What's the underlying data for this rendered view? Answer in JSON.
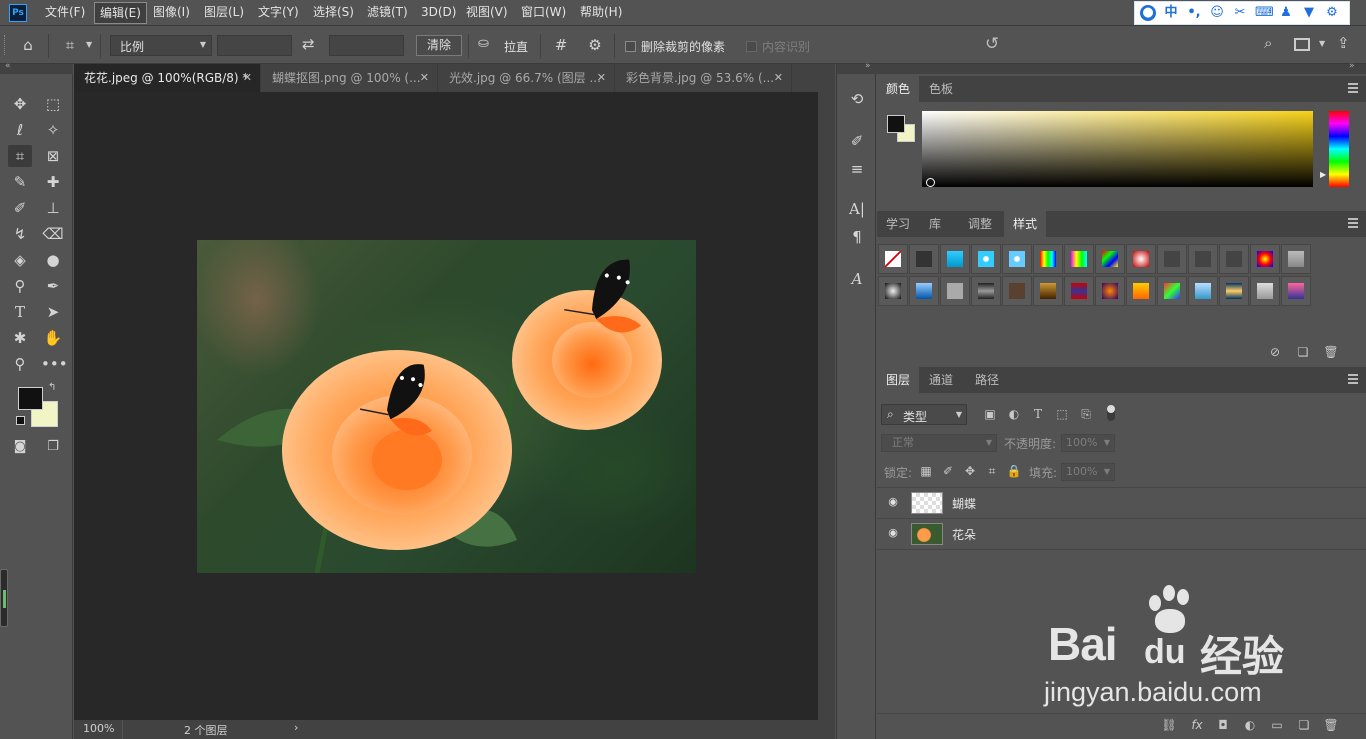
{
  "app": {
    "logo_text": "Ps"
  },
  "menu": {
    "items": [
      "文件(F)",
      "编辑(E)",
      "图像(I)",
      "图层(L)",
      "文字(Y)",
      "选择(S)",
      "滤镜(T)",
      "3D(D)",
      "视图(V)",
      "窗口(W)",
      "帮助(H)"
    ],
    "active": "编辑(E)"
  },
  "ime": {
    "lang": "中"
  },
  "options": {
    "ratio_select": "比例",
    "clear_button": "清除",
    "straighten_label": "拉直",
    "delete_cropped_label": "删除裁剪的像素",
    "content_aware_label": "内容识别"
  },
  "tabs": [
    {
      "label": "花花.jpeg @ 100%(RGB/8) *",
      "active": true
    },
    {
      "label": "蝴蝶抠图.png @ 100% (...",
      "active": false
    },
    {
      "label": "光效.jpg @ 66.7% (图层 ...",
      "active": false
    },
    {
      "label": "彩色背景.jpg @ 53.6% (...",
      "active": false
    }
  ],
  "status": {
    "zoom": "100%",
    "info": "2 个图层",
    "arrow": "›"
  },
  "color_panel": {
    "tabs": [
      "颜色",
      "色板"
    ],
    "active": "颜色",
    "foreground": "#111111",
    "background": "#f1f5c6"
  },
  "styles_panel": {
    "tabs": [
      "学习",
      "库",
      "调整",
      "样式"
    ],
    "active": "样式"
  },
  "layers_panel": {
    "tabs": [
      "图层",
      "通道",
      "路径"
    ],
    "active": "图层",
    "filter_label": "类型",
    "blend_mode": "正常",
    "opacity_label": "不透明度:",
    "opacity_value": "100%",
    "lock_label": "锁定:",
    "fill_label": "填充:",
    "fill_value": "100%",
    "layers": [
      {
        "name": "蝴蝶",
        "visible": true
      },
      {
        "name": "花朵",
        "visible": true
      }
    ]
  },
  "watermark": {
    "brand": "Bai",
    "brand2": "du",
    "cn": "经验",
    "url": "jingyan.baidu.com"
  },
  "colors": {
    "bg_panel": "#535353",
    "canvas": "#282828",
    "accent": "#2fa3f8"
  }
}
